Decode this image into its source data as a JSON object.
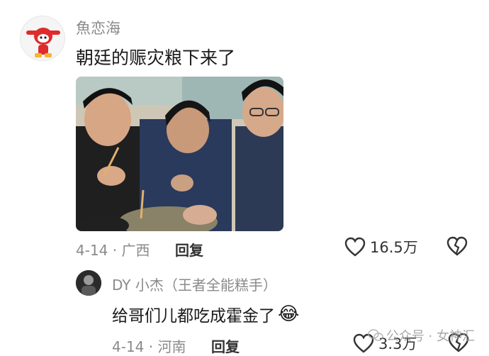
{
  "comment": {
    "username": "魚恋海",
    "text": "朝廷的赈灾粮下来了",
    "date": "4-14",
    "location": "广西",
    "reply_label": "回复",
    "likes": "16.5万"
  },
  "reply": {
    "username": "DY 小杰（王者全能糕手）",
    "text": "给哥们儿都吃成霍金了",
    "emoji": "😂",
    "date": "4-14",
    "location": "河南",
    "reply_label": "回复",
    "likes": "3.3万"
  },
  "watermark": {
    "text": "公众号 · 女神汇"
  },
  "colors": {
    "meta_gray": "#8a8a8a",
    "text_dark": "#1a1a1a"
  }
}
